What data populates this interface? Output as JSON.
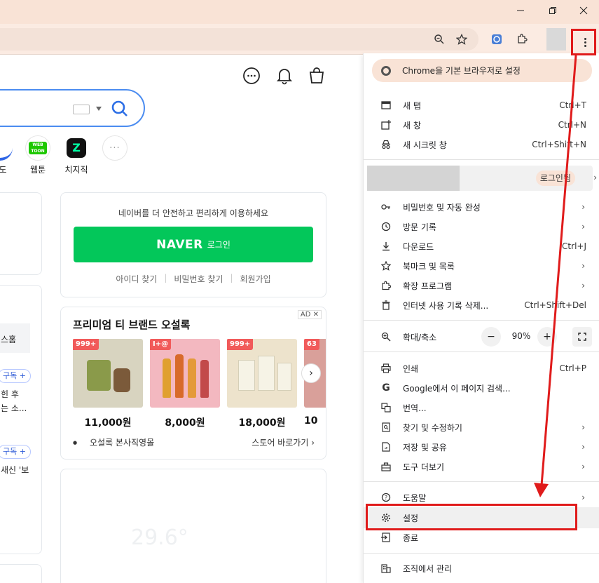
{
  "window": {
    "minimize_icon": "minimize-icon",
    "restore_icon": "restore-icon",
    "close_icon": "close-icon"
  },
  "toolbar": {
    "icons": [
      "zoom-icon",
      "bookmark-star-icon",
      "extension-app-icon",
      "extensions-puzzle-icon",
      "kebab-menu-icon"
    ]
  },
  "page": {
    "quick_links": [
      {
        "label": "도"
      },
      {
        "label": "웹툰",
        "badge": "WEB TOON"
      },
      {
        "label": "치지직",
        "badge": "Z"
      }
    ],
    "login": {
      "description": "네이버를 더 안전하고 편리하게 이용하세요",
      "brand": "NAVER",
      "button_sub": "로그인",
      "links": [
        "아이디 찾기",
        "비밀번호 찾기",
        "회원가입"
      ]
    },
    "ad": {
      "badge": "AD",
      "close": "✕",
      "title": "프리미엄 티 브랜드 오설록",
      "products": [
        {
          "badge": "999+",
          "price": "11,000원"
        },
        {
          "badge": "I+@",
          "price": "8,000원"
        },
        {
          "badge": "999+",
          "price": "18,000원"
        },
        {
          "badge": "63",
          "price": "10"
        }
      ],
      "store_name": "오설록 본사직영몰",
      "store_link": "스토어 바로가기 ›"
    },
    "left_snippets": {
      "tab": "스홈",
      "subscribe_1": "구독 +",
      "text_1a": "힌 후",
      "text_1b": "는 소...",
      "subscribe_2": "구독 +",
      "text_2": "새신 '보"
    },
    "weather": {
      "temp": "29.6°"
    }
  },
  "menu": {
    "default_browser": "Chrome을 기본 브라우저로 설정",
    "items": {
      "new_tab": {
        "label": "새 탭",
        "shortcut": "Ctrl+T"
      },
      "new_window": {
        "label": "새 창",
        "shortcut": "Ctrl+N"
      },
      "incognito": {
        "label": "새 시크릿 창",
        "shortcut": "Ctrl+Shift+N"
      },
      "passwords": {
        "label": "비밀번호 및 자동 완성"
      },
      "history": {
        "label": "방문 기록"
      },
      "downloads": {
        "label": "다운로드",
        "shortcut": "Ctrl+J"
      },
      "bookmarks": {
        "label": "북마크 및 목록"
      },
      "extensions": {
        "label": "확장 프로그램"
      },
      "clear_data": {
        "label": "인터넷 사용 기록 삭제...",
        "shortcut": "Ctrl+Shift+Del"
      },
      "zoom": {
        "label": "확대/축소",
        "minus": "−",
        "value": "90%",
        "plus": "+"
      },
      "print": {
        "label": "인쇄",
        "shortcut": "Ctrl+P"
      },
      "search_google": {
        "label": "Google에서 이 페이지 검색..."
      },
      "translate": {
        "label": "번역..."
      },
      "find_edit": {
        "label": "찾기 및 수정하기"
      },
      "save_share": {
        "label": "저장 및 공유"
      },
      "more_tools": {
        "label": "도구 더보기"
      },
      "help": {
        "label": "도움말"
      },
      "settings": {
        "label": "설정"
      },
      "exit": {
        "label": "종료"
      },
      "managed": {
        "label": "조직에서 관리"
      }
    },
    "profile": {
      "signin": "로그인됨"
    }
  },
  "annotation": {
    "color": "#e01b1b"
  }
}
